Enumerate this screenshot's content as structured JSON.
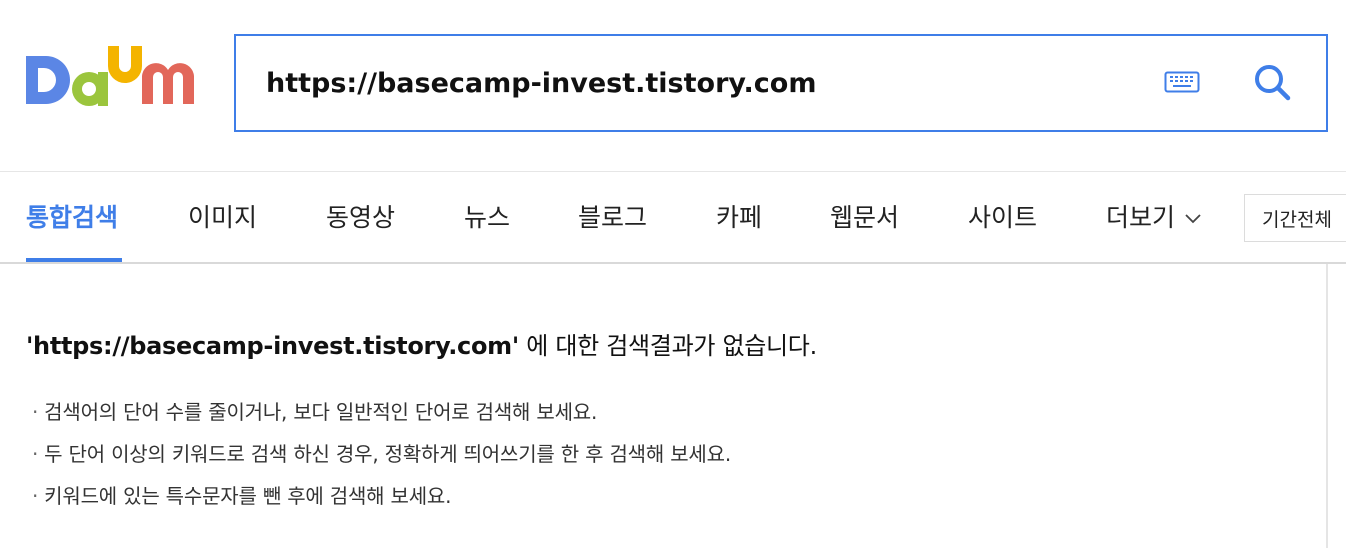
{
  "logo": {
    "text": "Daum",
    "colors": [
      "#5b86e5",
      "#f4b400",
      "#9bc53d",
      "#e2675a"
    ]
  },
  "search": {
    "query": "https://basecamp-invest.tistory.com",
    "accent": "#3f7ee8",
    "icons": {
      "keyboard": "keyboard-icon",
      "search": "search-icon"
    }
  },
  "tabs": [
    {
      "label": "통합검색",
      "active": true
    },
    {
      "label": "이미지"
    },
    {
      "label": "동영상"
    },
    {
      "label": "뉴스"
    },
    {
      "label": "블로그"
    },
    {
      "label": "카페"
    },
    {
      "label": "웹문서"
    },
    {
      "label": "사이트"
    }
  ],
  "more_tab": {
    "label": "더보기",
    "icon": "chevron-down-icon"
  },
  "period_filter": {
    "label": "기간전체"
  },
  "no_result": {
    "query_quoted": "'https://basecamp-invest.tistory.com'",
    "message": " 에 대한 검색결과가 없습니다.",
    "tips": [
      "검색어의 단어 수를 줄이거나, 보다 일반적인 단어로 검색해 보세요.",
      "두 단어 이상의 키워드로 검색 하신 경우, 정확하게 띄어쓰기를 한 후 검색해 보세요.",
      "키워드에 있는 특수문자를 뺀 후에 검색해 보세요."
    ]
  }
}
